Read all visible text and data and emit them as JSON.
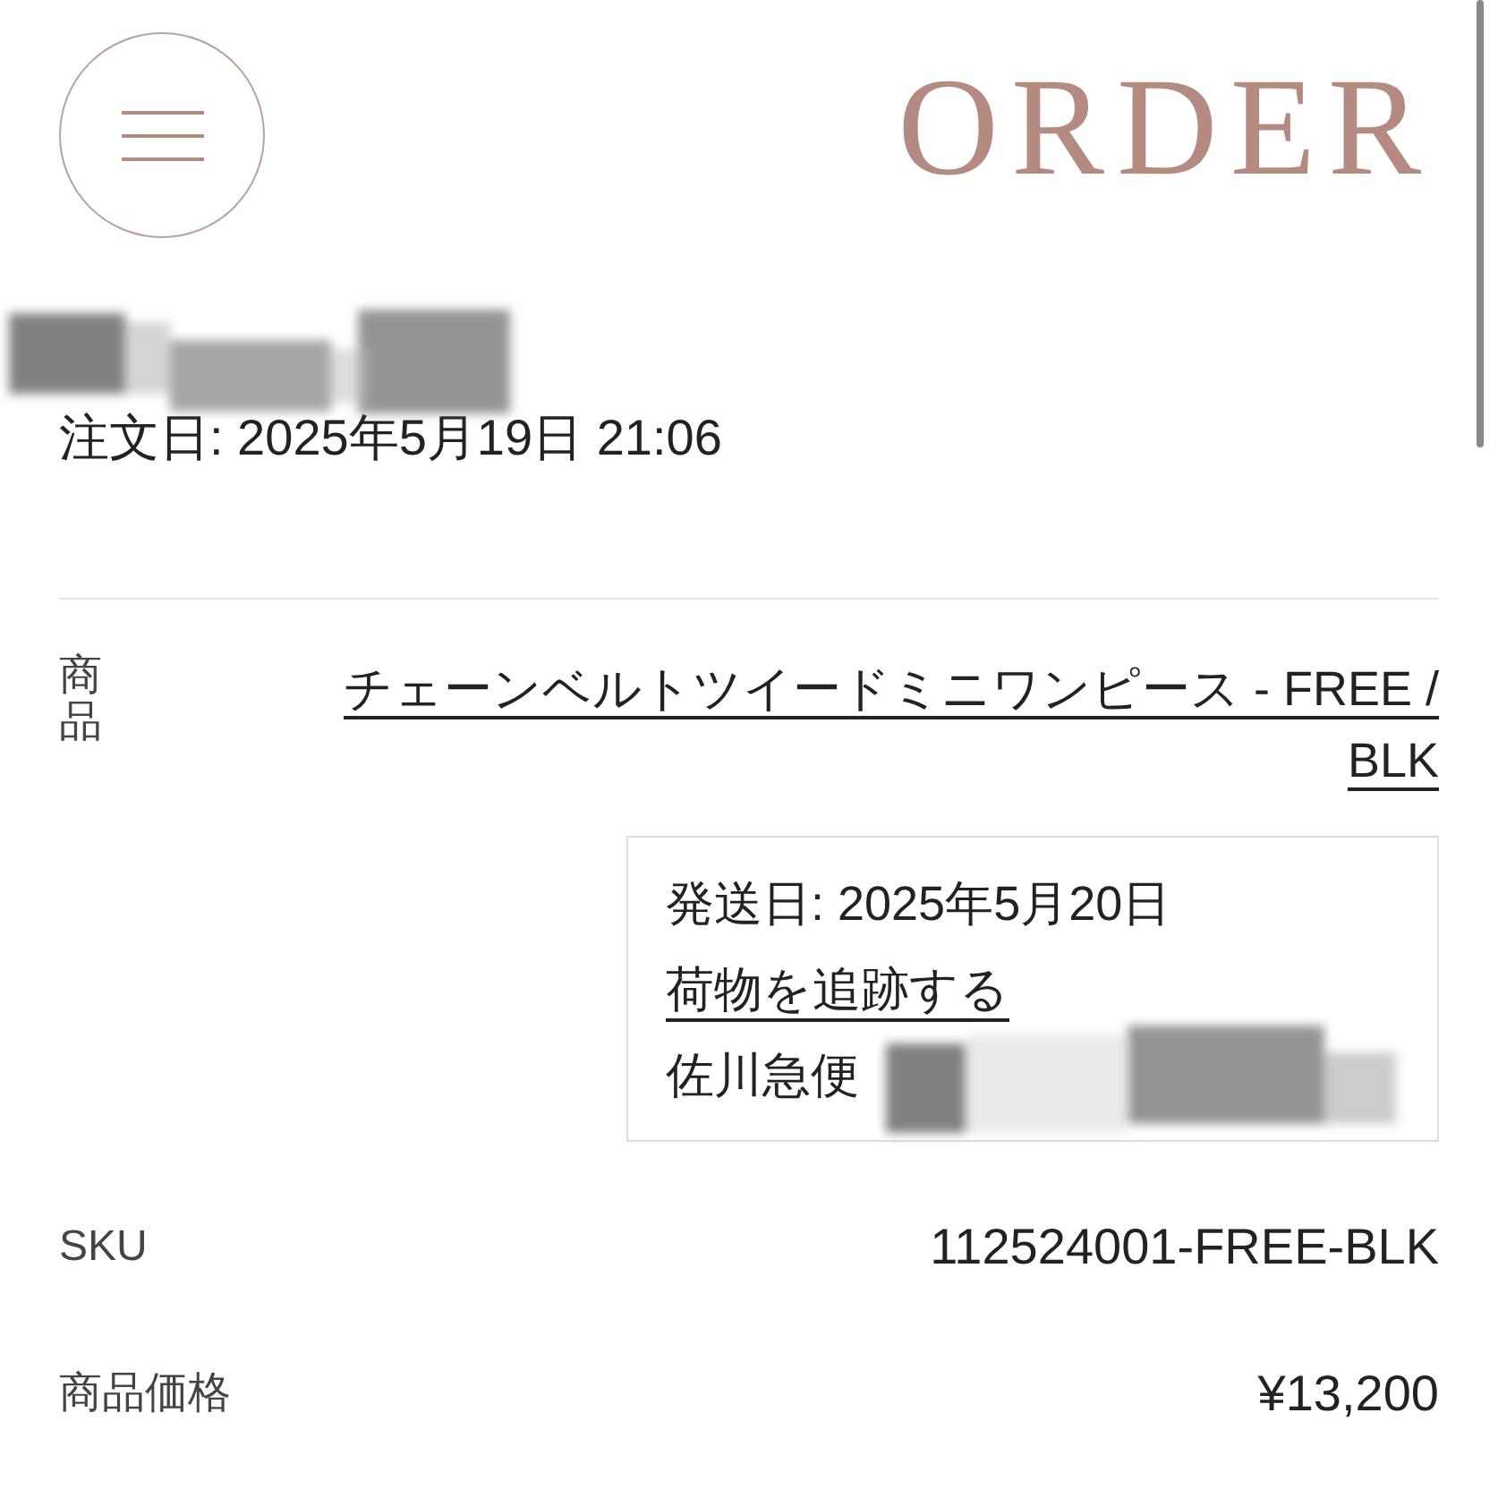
{
  "header": {
    "title": "ORDER"
  },
  "order_date": "注文日: 2025年5月19日 21:06",
  "product": {
    "label": "商品",
    "name": "チェーンベルトツイードミニワンピース - FREE / BLK"
  },
  "shipment": {
    "date": "発送日: 2025年5月20日",
    "tracking_link": "荷物を追跡する",
    "carrier": "佐川急便"
  },
  "details": [
    {
      "label": "SKU",
      "value": "112524001-FREE-BLK"
    },
    {
      "label": "商品価格",
      "value": "¥13,200"
    }
  ]
}
